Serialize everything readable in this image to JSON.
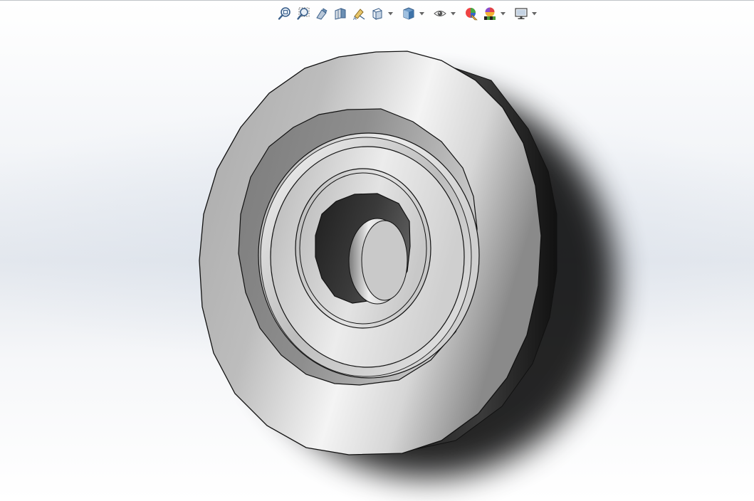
{
  "app": {
    "type": "cad-3d-graphics-area",
    "background_colors": [
      "#ffffff",
      "#e4e8ee",
      "#ffffff"
    ]
  },
  "toolbar": {
    "items": [
      {
        "name": "zoom-to-fit-icon",
        "has_dropdown": false
      },
      {
        "name": "zoom-to-area-icon",
        "has_dropdown": false
      },
      {
        "name": "previous-view-icon",
        "has_dropdown": false
      },
      {
        "name": "section-view-icon",
        "has_dropdown": false
      },
      {
        "name": "dynamic-annotation-views-icon",
        "has_dropdown": false
      },
      {
        "name": "view-orientation-icon",
        "has_dropdown": true
      },
      {
        "name": "display-style-icon",
        "has_dropdown": true
      },
      {
        "name": "hide-show-items-icon",
        "has_dropdown": true
      },
      {
        "name": "edit-appearance-icon",
        "has_dropdown": false
      },
      {
        "name": "apply-scene-icon",
        "has_dropdown": true
      },
      {
        "name": "view-settings-icon",
        "has_dropdown": true
      }
    ]
  },
  "model": {
    "part": "stepped-flange-washer",
    "colors": {
      "face_light": "#f2f2f2",
      "face_mid": "#b9b9b9",
      "face_dark": "#6e6e6e",
      "side_dark": "#2a2a2a",
      "edge": "#111111",
      "shadow": "#000000"
    }
  }
}
